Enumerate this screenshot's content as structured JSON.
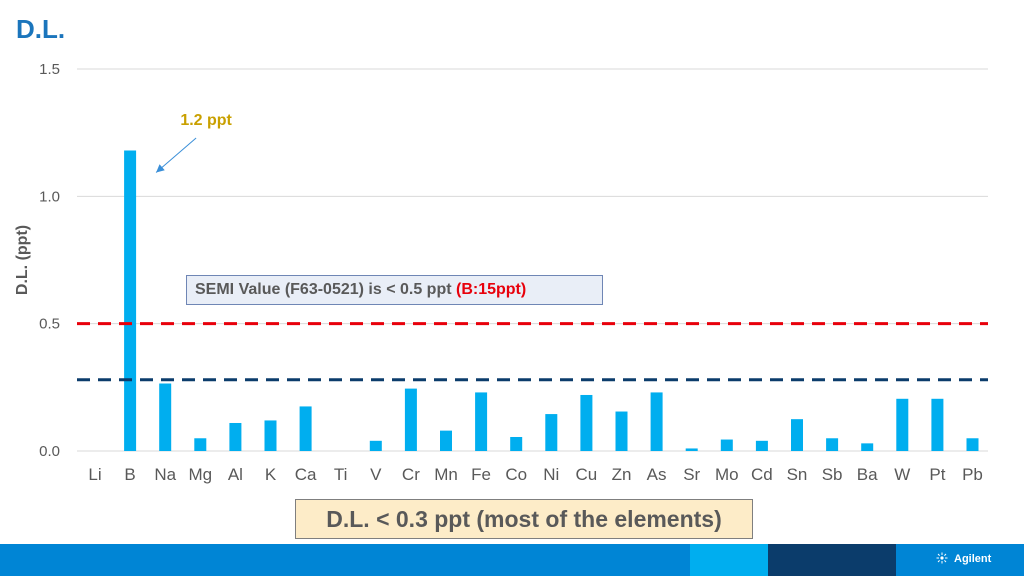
{
  "slide": {
    "title": "D.L."
  },
  "chart_data": {
    "type": "bar",
    "ylabel": "D.L. (ppt)",
    "xlabel": "",
    "ylim": [
      0,
      1.5
    ],
    "yticks": [
      "0.0",
      "0.5",
      "1.0",
      "1.5"
    ],
    "ytick_values": [
      0,
      0.5,
      1.0,
      1.5
    ],
    "grid": true,
    "categories": [
      "Li",
      "B",
      "Na",
      "Mg",
      "Al",
      "K",
      "Ca",
      "Ti",
      "V",
      "Cr",
      "Mn",
      "Fe",
      "Co",
      "Ni",
      "Cu",
      "Zn",
      "As",
      "Sr",
      "Mo",
      "Cd",
      "Sn",
      "Sb",
      "Ba",
      "W",
      "Pt",
      "Pb"
    ],
    "values": [
      0,
      1.18,
      0.265,
      0.05,
      0.11,
      0.12,
      0.175,
      0,
      0.04,
      0.245,
      0.08,
      0.23,
      0.055,
      0.145,
      0.22,
      0.155,
      0.23,
      0.01,
      0.045,
      0.04,
      0.125,
      0.05,
      0.03,
      0.205,
      0.205,
      0.05
    ],
    "bar_color": "#00aeef",
    "reference_lines": [
      {
        "value": 0.5,
        "color": "#e8000b",
        "style": "dashed"
      },
      {
        "value": 0.28,
        "color": "#0b3c6b",
        "style": "dashed"
      }
    ],
    "annotations": [
      {
        "text": "1.2 ppt",
        "target": "B",
        "color": "#c9a000"
      }
    ]
  },
  "semi_note": {
    "text": "SEMI Value (F63-0521) is < 0.5 ppt ",
    "highlight": "(B:15ppt)"
  },
  "dl_note": {
    "text": "D.L. < 0.3 ppt (most of the elements)"
  },
  "footer": {
    "brand": "Agilent",
    "colors": {
      "bar": "#0085d5",
      "light": "#00aeef",
      "dark": "#0b3c6b"
    }
  }
}
